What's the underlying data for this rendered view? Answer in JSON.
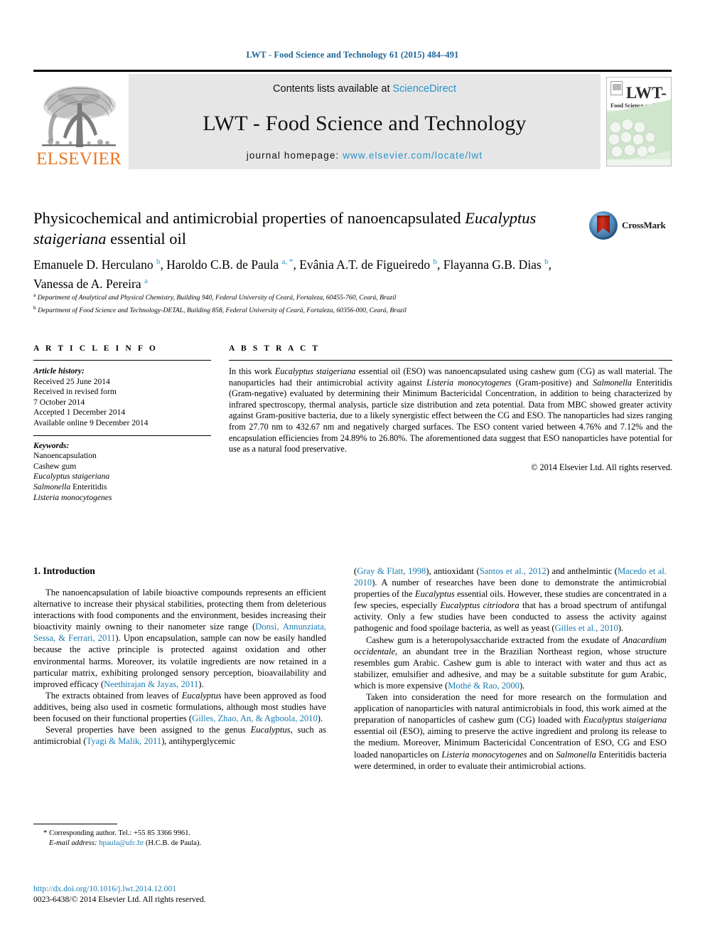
{
  "running_head": "LWT - Food Science and Technology 61 (2015) 484–491",
  "masthead": {
    "publisher_name": "ELSEVIER",
    "contents_prefix": "Contents lists available at ",
    "contents_link": "ScienceDirect",
    "journal_title": "LWT - Food Science and Technology",
    "homepage_prefix": "journal homepage: ",
    "homepage_url": "www.elsevier.com/locate/lwt",
    "cover": {
      "title": "LWT-",
      "subtitle": "Food Science and Technology"
    }
  },
  "article": {
    "title_line1": "Physicochemical and antimicrobial properties of nanoencapsulated",
    "title_italic": "Eucalyptus staigeriana",
    "title_line2_rest": " essential oil",
    "crossmark_label": "CrossMark",
    "authors": [
      {
        "name": "Emanuele D. Herculano",
        "marks": "b",
        "sep": ", "
      },
      {
        "name": "Haroldo C.B. de Paula",
        "marks": "a, *",
        "sep": ", "
      },
      {
        "name": "Evânia A.T. de Figueiredo",
        "marks": "b",
        "sep": ", "
      },
      {
        "name": "Flayanna G.B. Dias",
        "marks": "b",
        "sep": ", "
      },
      {
        "name": "Vanessa de A. Pereira",
        "marks": "a",
        "sep": ""
      }
    ],
    "affiliations": [
      {
        "mark": "a",
        "text": "Department of Analytical and Physical Chemistry, Building 940, Federal University of Ceará, Fortaleza, 60455-760, Ceará, Brazil"
      },
      {
        "mark": "b",
        "text": "Department of Food Science and Technology-DETAL, Building 858, Federal University of Ceará, Fortaleza, 60356-000, Ceará, Brazil"
      }
    ]
  },
  "article_info": {
    "heading": "A R T I C L E  I N F O",
    "history_label": "Article history:",
    "history": [
      "Received 25 June 2014",
      "Received in revised form",
      "7 October 2014",
      "Accepted 1 December 2014",
      "Available online 9 December 2014"
    ],
    "keywords_label": "Keywords:",
    "keywords": [
      "Nanoencapsulation",
      "Cashew gum",
      "Eucalyptus staigeriana",
      "Salmonella Enteritidis",
      "Listeria monocytogenes"
    ]
  },
  "abstract": {
    "heading": "A B S T R A C T",
    "text": "In this work Eucalyptus staigeriana essential oil (ESO) was nanoencapsulated using cashew gum (CG) as wall material. The nanoparticles had their antimicrobial activity against Listeria monocytogenes (Gram-positive) and Salmonella Enteritidis (Gram-negative) evaluated by determining their Minimum Bactericidal Concentration, in addition to being characterized by infrared spectroscopy, thermal analysis, particle size distribution and zeta potential. Data from MBC showed greater activity against Gram-positive bacteria, due to a likely synergistic effect between the CG and ESO. The nanoparticles had sizes ranging from 27.70 nm to 432.67 nm and negatively charged surfaces. The ESO content varied between 4.76% and 7.12% and the encapsulation efficiencies from 24.89% to 26.80%. The aforementioned data suggest that ESO nanoparticles have potential for use as a natural food preservative.",
    "copyright": "© 2014 Elsevier Ltd. All rights reserved."
  },
  "body": {
    "section_title": "1. Introduction",
    "left_paragraphs": [
      "The nanoencapsulation of labile bioactive compounds represents an efficient alternative to increase their physical stabilities, protecting them from deleterious interactions with food components and the environment, besides increasing their bioactivity mainly owning to their nanometer size range (Donsì, Annunziata, Sessa, & Ferrari, 2011). Upon encapsulation, sample can now be easily handled because the active principle is protected against oxidation and other environmental harms. Moreover, its volatile ingredients are now retained in a particular matrix, exhibiting prolonged sensory perception, bioavailability and improved efficacy (Neethirajan & Jayas, 2011).",
      "The extracts obtained from leaves of Eucalyptus have been approved as food additives, being also used in cosmetic formulations, although most studies have been focused on their functional properties (Gilles, Zhao, An, & Agboola, 2010).",
      "Several properties have been assigned to the genus Eucalyptus, such as antimicrobial (Tyagi & Malik, 2011), antihyperglycemic"
    ],
    "right_paragraphs": [
      "(Gray & Flatt, 1998), antioxidant (Santos et al., 2012) and anthelmintic (Macedo et al. 2010). A number of researches have been done to demonstrate the antimicrobial properties of the Eucalyptus essential oils. However, these studies are concentrated in a few species, especially Eucalyptus citriodora that has a broad spectrum of antifungal activity. Only a few studies have been conducted to assess the activity against pathogenic and food spoilage bacteria, as well as yeast (Gilles et al., 2010).",
      "Cashew gum is a heteropolysaccharide extracted from the exudate of Anacardium occidentale, an abundant tree in the Brazilian Northeast region, whose structure resembles gum Arabic. Cashew gum is able to interact with water and thus act as stabilizer, emulsifier and adhesive, and may be a suitable substitute for gum Arabic, which is more expensive (Mothé & Rao, 2000).",
      "Taken into consideration the need for more research on the formulation and application of nanoparticles with natural antimicrobials in food, this work aimed at the preparation of nanoparticles of cashew gum (CG) loaded with Eucalyptus staigeriana essential oil (ESO), aiming to preserve the active ingredient and prolong its release to the medium. Moreover, Minimum Bactericidal Concentration of ESO, CG and ESO loaded nanoparticles on Listeria monocytogenes and on Salmonella Enteritidis bacteria were determined, in order to evaluate their antimicrobial actions."
    ]
  },
  "footer": {
    "corresponding_star": "*",
    "corresponding_text": "Corresponding author. Tel.: +55 85 3366 9961.",
    "email_label": "E-mail address:",
    "email": "hpaula@ufc.br",
    "email_suffix": "(H.C.B. de Paula).",
    "doi": "http://dx.doi.org/10.1016/j.lwt.2014.12.001",
    "issn_line": "0023-6438/© 2014 Elsevier Ltd. All rights reserved."
  },
  "colors": {
    "link_blue": "#1a7bb0",
    "header_blue": "#1a6496",
    "sciencedirect_blue": "#2a93c9",
    "elsevier_orange": "#E87722",
    "band_gray": "#e6e6e6"
  }
}
